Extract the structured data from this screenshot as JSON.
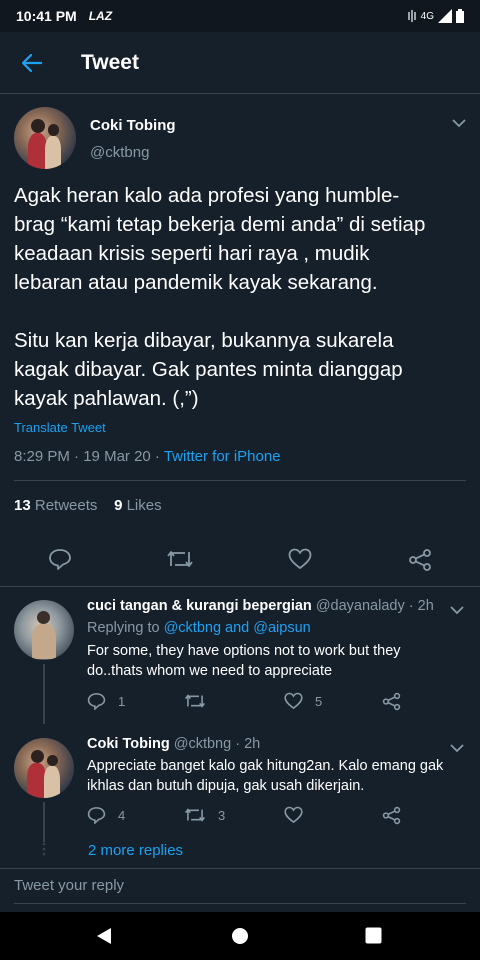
{
  "status_bar": {
    "time": "10:41 PM",
    "carrier": "LAZ",
    "network": "4G"
  },
  "header": {
    "title": "Tweet"
  },
  "tweet": {
    "author_name": "Coki Tobing",
    "author_handle": "@cktbng",
    "text_lines": [
      "Agak heran kalo ada profesi yang humble-",
      "brag “kami tetap bekerja demi anda” di setiap",
      "keadaan krisis seperti hari raya , mudik",
      "lebaran atau pandemik kayak sekarang."
    ],
    "text_lines_2": [
      "Situ kan kerja dibayar, bukannya sukarela",
      "kagak dibayar. Gak pantes minta dianggap",
      "kayak pahlawan. (,”)"
    ],
    "translate_label": "Translate Tweet",
    "time": "8:29 PM",
    "date": "19 Mar 20",
    "source": "Twitter for iPhone",
    "retweets_count": "13",
    "retweets_label": "Retweets",
    "likes_count": "9",
    "likes_label": "Likes"
  },
  "replies": [
    {
      "name": "cuci tangan & kurangi bepergian",
      "handle": "@dayanalady",
      "time": "2h",
      "replying_prefix": "Replying to",
      "replying_to": "@cktbng and @aipsun",
      "text_lines": [
        "For some, they have options not to work but they",
        "do..thats whom we need to appreciate"
      ],
      "reply_count": "1",
      "retweet_count": "",
      "like_count": "5"
    },
    {
      "name": "Coki Tobing",
      "handle": "@cktbng",
      "time": "2h",
      "text_lines": [
        "Appreciate banget kalo gak hitung2an. Kalo emang gak",
        "ikhlas dan butuh dipuja, gak usah dikerjain."
      ],
      "reply_count": "4",
      "retweet_count": "3",
      "like_count": ""
    }
  ],
  "more_replies": "2 more replies",
  "compose_placeholder": "Tweet your reply",
  "colors": {
    "background": "#15202b",
    "accent": "#1da1f2",
    "secondary_text": "#8899a6",
    "divider": "#38444d"
  }
}
